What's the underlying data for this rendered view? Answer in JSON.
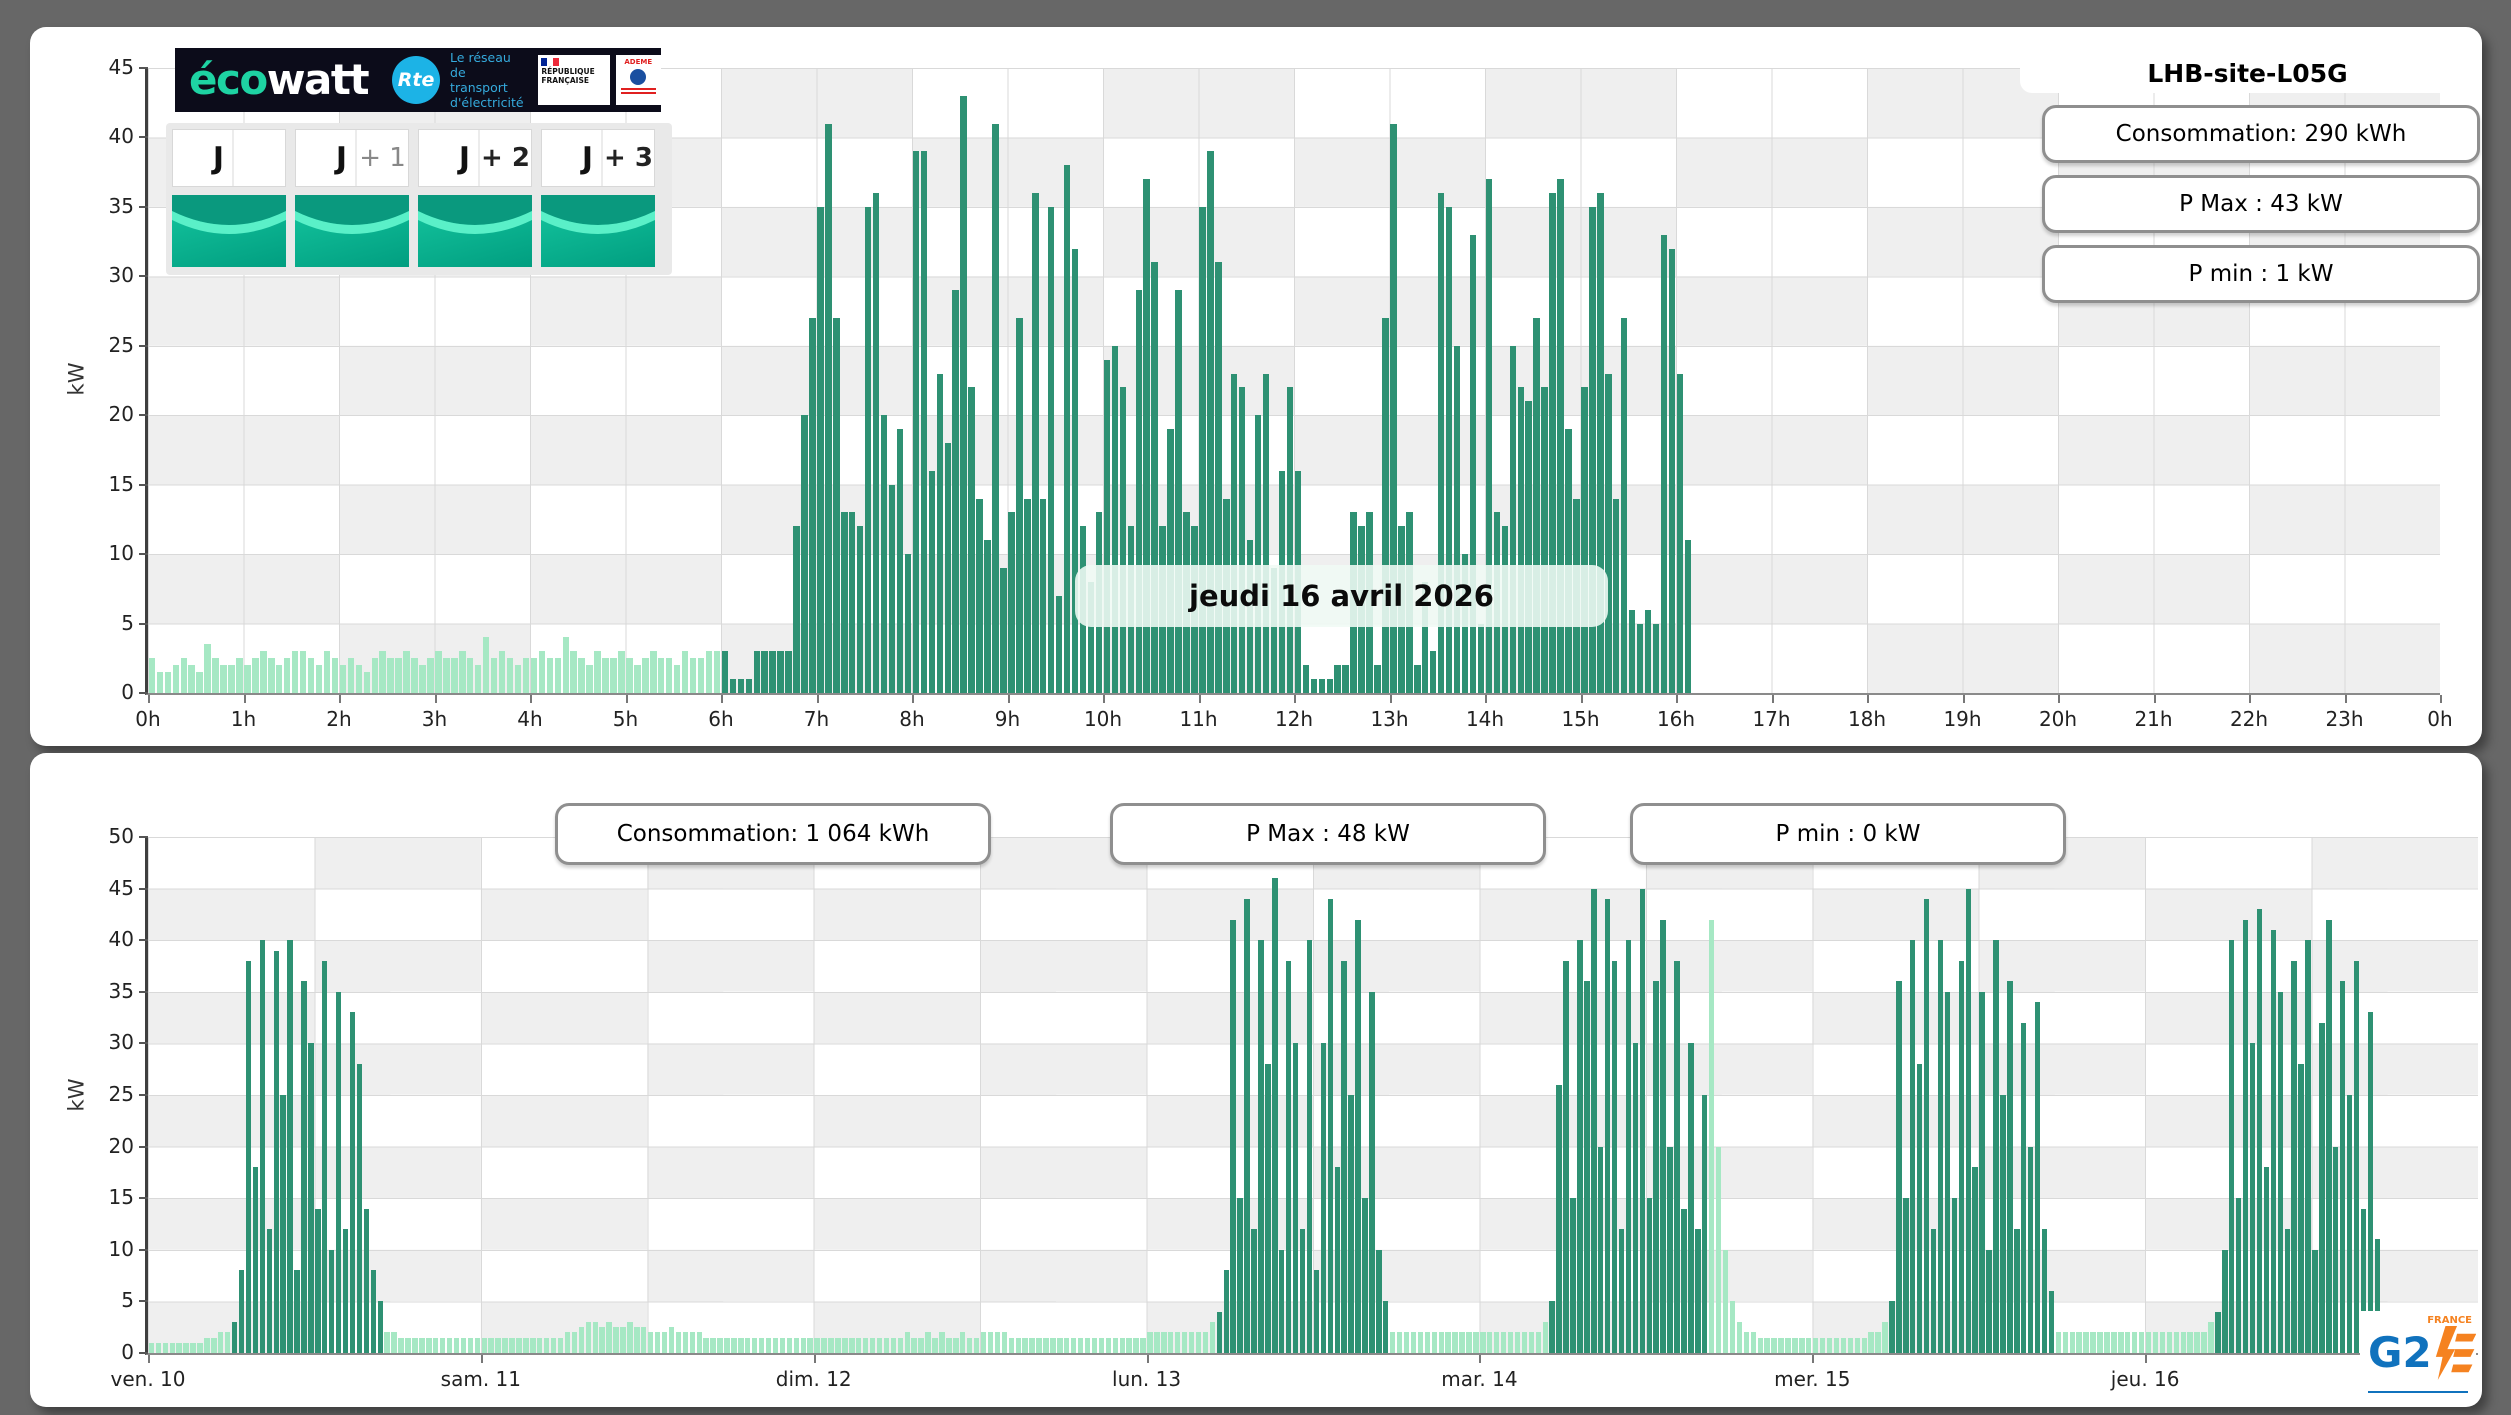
{
  "site": {
    "title": "LHB-site-L05G"
  },
  "colors": {
    "bar_dark": "#2E9173",
    "bar_light": "#A6E8C4",
    "grid": "#d9d9d9",
    "cell_gray": "#efefef",
    "cell_white": "#ffffff",
    "accent_teal": "#1ed3a3",
    "rte_blue": "#1cb3e6",
    "g2e_blue": "#1072bd",
    "g2e_orange": "#f58220"
  },
  "top_stats": [
    {
      "label": "Consommation: 290 kWh"
    },
    {
      "label": "P Max :  43 kW"
    },
    {
      "label": "P min : 1 kW"
    }
  ],
  "bottom_stats": [
    {
      "label": "Consommation: 1 064 kWh"
    },
    {
      "label": "P Max :  48 kW"
    },
    {
      "label": "P min : 0 kW"
    }
  ],
  "ecowatt": {
    "brand_eco": "éco",
    "brand_watt": "watt",
    "rte_abbr": "Rte",
    "rte_tagline": [
      "Le réseau",
      "de transport",
      "d'électricité"
    ],
    "gov_label": "RÉPUBLIQUE FRANÇAISE",
    "ademe_label": "ADEME",
    "day_buttons": [
      {
        "main": "J",
        "suffix": ""
      },
      {
        "main": "J",
        "suffix": "+ 1"
      },
      {
        "main": "J",
        "suffix": "+ 2"
      },
      {
        "main": "J",
        "suffix": "+ 3"
      }
    ],
    "signal_status": "green"
  },
  "g2e": {
    "name": "G2",
    "e": "E",
    "country": "FRANCE"
  },
  "chart_data": [
    {
      "id": "intraday",
      "type": "bar",
      "annotation": "jeudi 16 avril 2026",
      "ylabel": "kW",
      "ylim": [
        0,
        45
      ],
      "ytick_step": 5,
      "y_tick_labels": [
        "0",
        "5",
        "10",
        "15",
        "20",
        "25",
        "30",
        "35",
        "40",
        "45"
      ],
      "x_label_align": "edge",
      "x_tick_labels": [
        "0h",
        "1h",
        "2h",
        "3h",
        "4h",
        "5h",
        "6h",
        "7h",
        "8h",
        "9h",
        "10h",
        "11h",
        "12h",
        "13h",
        "14h",
        "15h",
        "16h",
        "17h",
        "18h",
        "19h",
        "20h",
        "21h",
        "22h",
        "23h",
        "0h"
      ],
      "slot_minutes": 5,
      "slot_count": 288,
      "dark_ranges": [
        [
          72,
          194
        ]
      ],
      "values": [
        2.5,
        1.5,
        1.5,
        2,
        2.5,
        2,
        1.5,
        3.5,
        2.5,
        2,
        2,
        2.5,
        2,
        2.5,
        3,
        2.5,
        2,
        2.5,
        3,
        3,
        2.5,
        2,
        3,
        2.5,
        2,
        2.5,
        2,
        1.5,
        2.5,
        3,
        2.5,
        2.5,
        3,
        2.5,
        2,
        2.5,
        3,
        2.5,
        2.5,
        3,
        2.5,
        2,
        4,
        2.5,
        3,
        2.5,
        2,
        2.5,
        2.5,
        3,
        2.5,
        2.5,
        4,
        3,
        2.5,
        2,
        3,
        2.5,
        2.5,
        3,
        2.5,
        2,
        2.5,
        3,
        2.5,
        2.5,
        2,
        3,
        2.5,
        2.5,
        3,
        3,
        3,
        1,
        1,
        1,
        3,
        3,
        3,
        3,
        3,
        12,
        20,
        27,
        35,
        41,
        27,
        13,
        13,
        12,
        35,
        36,
        20,
        15,
        19,
        10,
        39,
        39,
        16,
        23,
        18,
        29,
        43,
        22,
        14,
        11,
        41,
        9,
        13,
        27,
        14,
        36,
        14,
        35,
        7,
        38,
        32,
        12,
        8,
        13,
        24,
        25,
        22,
        12,
        29,
        37,
        31,
        12,
        19,
        29,
        13,
        12,
        35,
        39,
        31,
        14,
        23,
        22,
        11,
        20,
        23,
        9,
        16,
        22,
        16,
        2,
        1,
        1,
        1,
        2,
        2,
        13,
        12,
        13,
        2,
        27,
        41,
        12,
        13,
        2,
        8,
        3,
        36,
        35,
        25,
        10,
        33,
        5,
        37,
        13,
        12,
        25,
        22,
        21,
        27,
        22,
        36,
        37,
        19,
        14,
        22,
        35,
        36,
        23,
        14,
        27,
        6,
        5,
        6,
        5,
        33,
        32,
        23,
        11
      ]
    },
    {
      "id": "week",
      "type": "bar",
      "ylabel": "kW",
      "ylim": [
        0,
        50
      ],
      "ytick_step": 5,
      "y_tick_labels": [
        "0",
        "5",
        "10",
        "15",
        "20",
        "25",
        "30",
        "35",
        "40",
        "45",
        "50"
      ],
      "x_label_align": "interval-start",
      "x_tick_labels": [
        "ven. 10",
        "sam. 11",
        "dim. 12",
        "lun. 13",
        "mar. 14",
        "mer. 15",
        "jeu. 16"
      ],
      "slot_minutes": 30,
      "slot_count": 336,
      "dark_ranges": [
        [
          12,
          34
        ],
        [
          154,
          179
        ],
        [
          202,
          225
        ],
        [
          251,
          275
        ],
        [
          298,
          322
        ]
      ],
      "values": [
        1,
        1,
        1,
        1,
        1,
        1,
        1,
        1,
        1.5,
        1.5,
        2,
        2,
        3,
        8,
        38,
        18,
        40,
        12,
        39,
        25,
        40,
        8,
        36,
        30,
        14,
        38,
        10,
        35,
        12,
        33,
        28,
        14,
        8,
        5,
        2,
        2,
        1.5,
        1.5,
        1.5,
        1.5,
        1.5,
        1.5,
        1.5,
        1.5,
        1.5,
        1.5,
        1.5,
        1.5,
        1.5,
        1.5,
        1.5,
        1.5,
        1.5,
        1.5,
        1.5,
        1.5,
        1.5,
        1.5,
        1.5,
        1.5,
        2,
        2,
        2.5,
        3,
        3,
        2.5,
        3,
        2.5,
        2.5,
        3,
        2.5,
        2.5,
        2,
        2,
        2,
        2.5,
        2,
        2,
        2,
        2,
        1.5,
        1.5,
        1.5,
        1.5,
        1.5,
        1.5,
        1.5,
        1.5,
        1.5,
        1.5,
        1.5,
        1.5,
        1.5,
        1.5,
        1.5,
        1.5,
        1.5,
        1.5,
        1.5,
        1.5,
        1.5,
        1.5,
        1.5,
        1.5,
        1.5,
        1.5,
        1.5,
        1.5,
        1.5,
        2,
        1.5,
        1.5,
        2,
        1.5,
        2,
        1.5,
        1.5,
        2,
        1.5,
        1.5,
        2,
        2,
        2,
        2,
        1.5,
        1.5,
        1.5,
        1.5,
        1.5,
        1.5,
        1.5,
        1.5,
        1.5,
        1.5,
        1.5,
        1.5,
        1.5,
        1.5,
        1.5,
        1.5,
        1.5,
        1.5,
        1.5,
        1.5,
        2,
        2,
        2,
        2,
        2,
        2,
        2,
        2,
        2,
        3,
        4,
        8,
        42,
        15,
        44,
        12,
        40,
        28,
        46,
        10,
        38,
        30,
        12,
        40,
        8,
        30,
        44,
        18,
        38,
        25,
        42,
        15,
        35,
        10,
        5,
        2,
        2,
        2,
        2,
        2,
        2,
        2,
        2,
        2,
        2,
        2,
        2,
        2,
        2,
        2,
        2,
        2,
        2,
        2,
        2,
        2,
        2,
        3,
        5,
        26,
        38,
        15,
        40,
        36,
        45,
        20,
        44,
        38,
        12,
        40,
        30,
        45,
        15,
        36,
        42,
        20,
        38,
        14,
        30,
        12,
        25,
        42,
        20,
        10,
        5,
        3,
        2,
        2,
        1.5,
        1.5,
        1.5,
        1.5,
        1.5,
        1.5,
        1.5,
        1.5,
        1.5,
        1.5,
        1.5,
        1.5,
        1.5,
        1.5,
        1.5,
        1.5,
        2,
        2,
        3,
        5,
        36,
        15,
        40,
        28,
        44,
        12,
        40,
        35,
        15,
        38,
        45,
        18,
        35,
        10,
        40,
        25,
        36,
        12,
        32,
        20,
        34,
        12,
        6,
        2,
        2,
        2,
        2,
        2,
        2,
        2,
        2,
        2,
        2,
        2,
        2,
        2,
        2,
        2,
        2,
        2,
        2,
        2,
        2,
        2,
        2,
        3,
        4,
        10,
        40,
        15,
        42,
        30,
        43,
        18,
        41,
        35,
        12,
        38,
        28,
        40,
        10,
        32,
        42,
        20,
        36,
        25,
        38,
        14,
        33,
        11
      ]
    }
  ]
}
